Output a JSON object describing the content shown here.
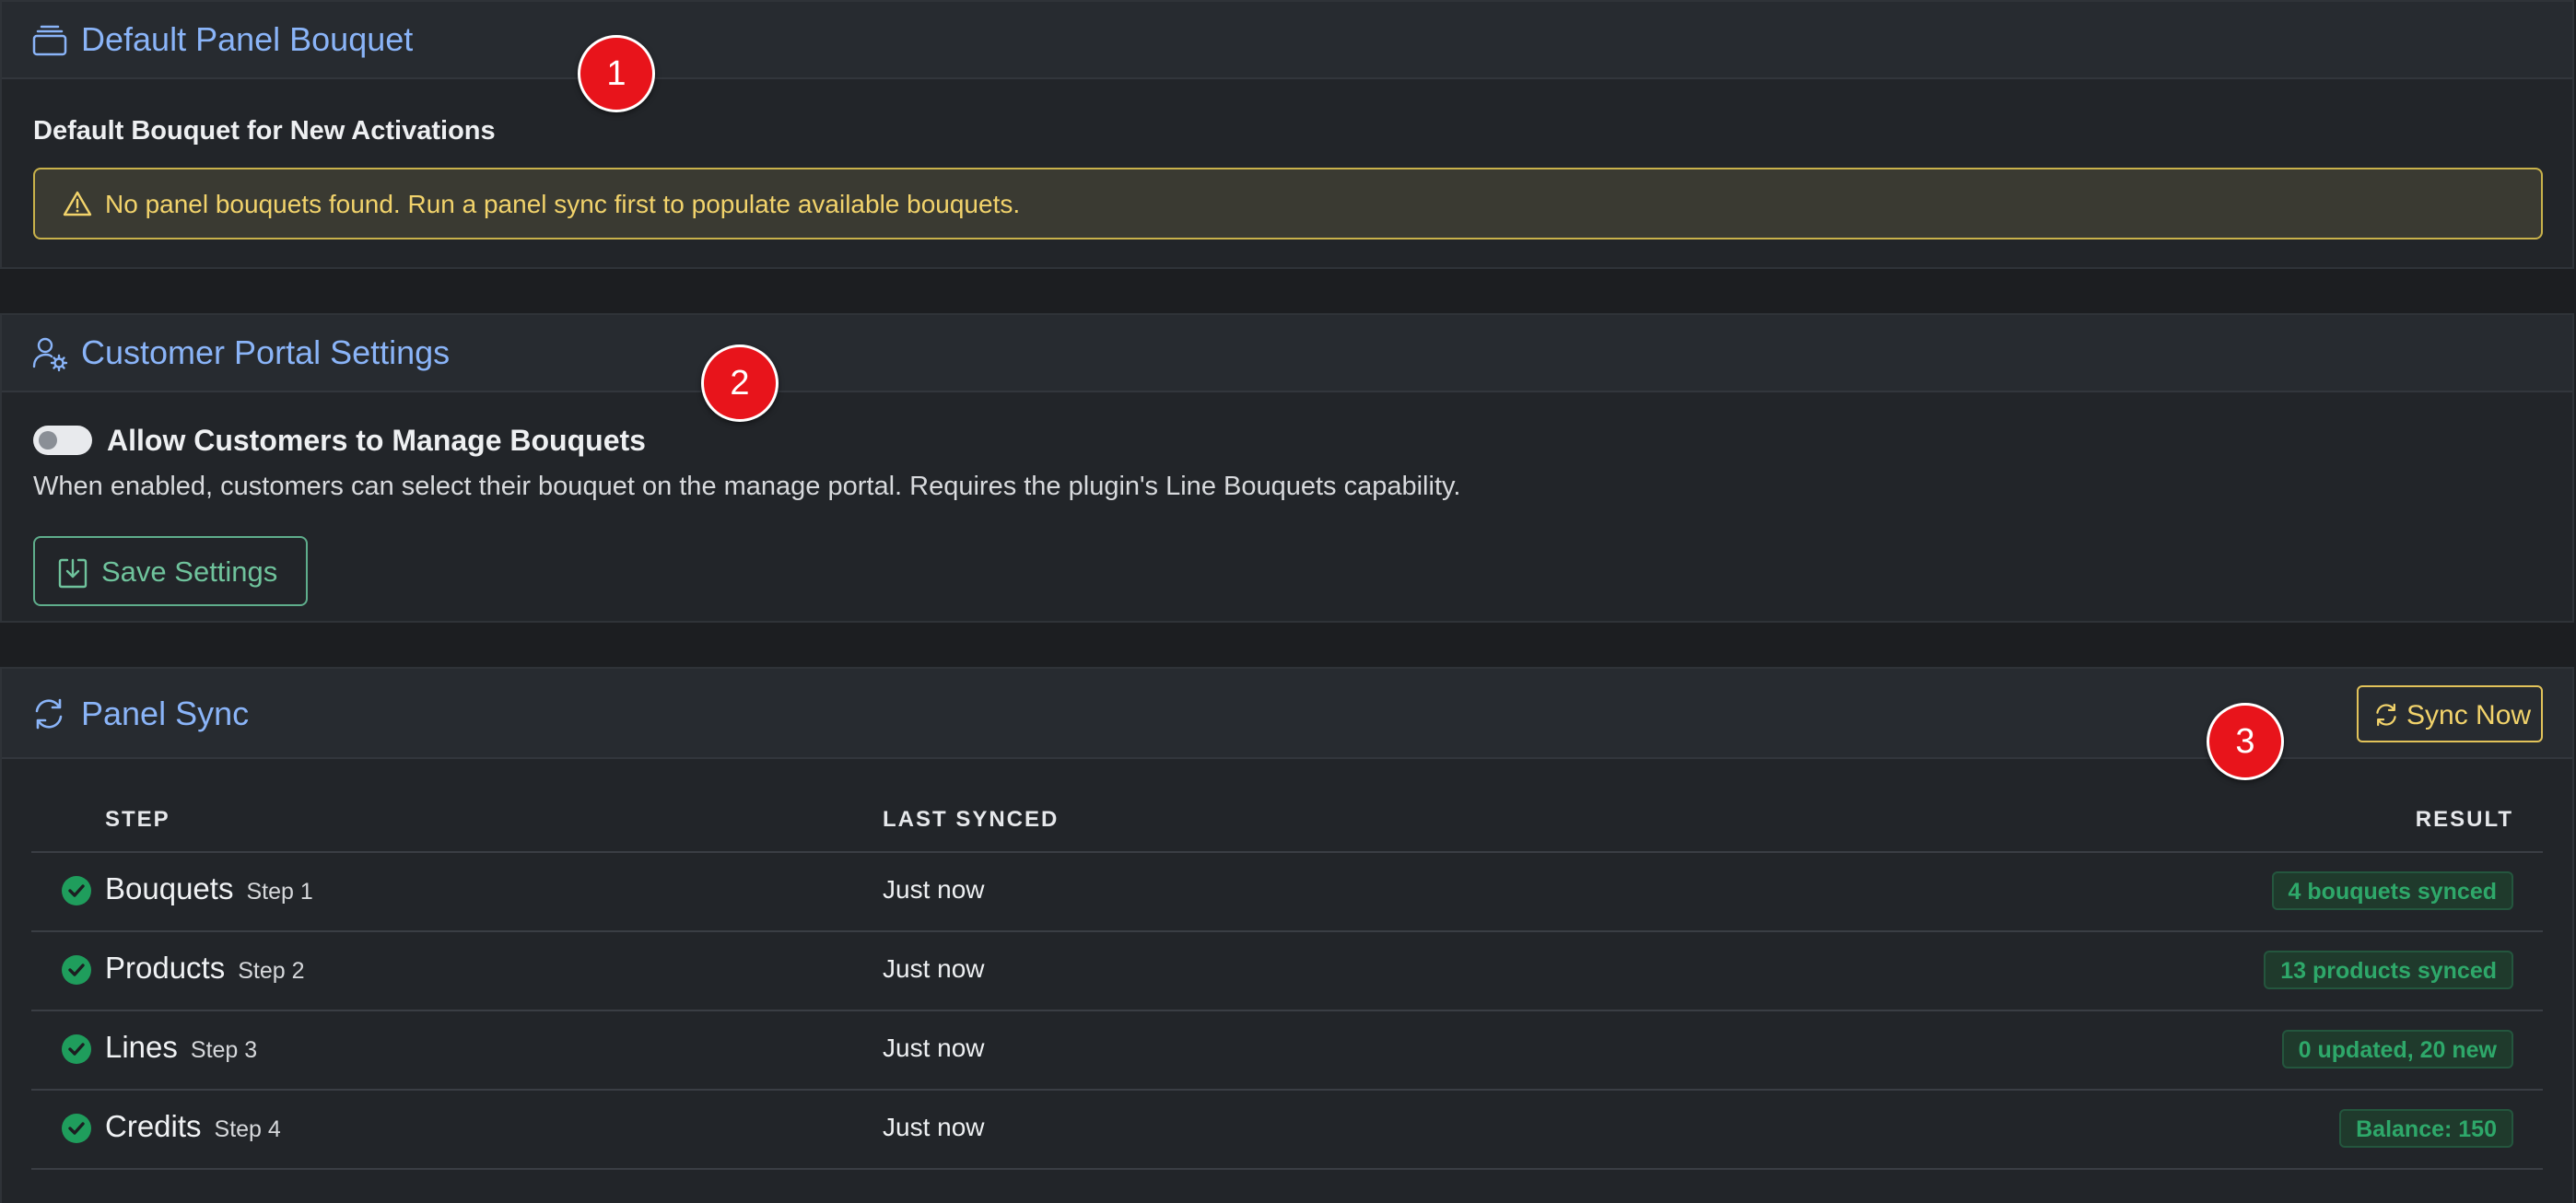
{
  "bouquet_card": {
    "title": "Default Panel Bouquet",
    "icon": "stack-icon",
    "field_label": "Default Bouquet for New Activations",
    "alert": {
      "icon": "warning-icon",
      "text": "No panel bouquets found. Run a panel sync first to populate available bouquets.",
      "color": "#f2d36b"
    }
  },
  "portal_card": {
    "title": "Customer Portal Settings",
    "icon": "user-gear-icon",
    "toggle": {
      "label": "Allow Customers to Manage Bouquets",
      "enabled": false
    },
    "help_text": "When enabled, customers can select their bouquet on the manage portal. Requires the plugin's Line Bouquets capability.",
    "save_button": {
      "label": "Save Settings",
      "icon": "save-icon",
      "color": "#6fc39c"
    }
  },
  "sync_card": {
    "title": "Panel Sync",
    "icon": "sync-icon",
    "sync_button": {
      "label": "Sync Now",
      "icon": "sync-icon",
      "color": "#f2d36b"
    },
    "columns": {
      "step": "STEP",
      "last_synced": "LAST SYNCED",
      "result": "RESULT"
    },
    "rows": [
      {
        "name": "Bouquets",
        "sub": "Step 1",
        "last_synced": "Just now",
        "result": "4 bouquets synced",
        "status": "success"
      },
      {
        "name": "Products",
        "sub": "Step 2",
        "last_synced": "Just now",
        "result": "13 products synced",
        "status": "success"
      },
      {
        "name": "Lines",
        "sub": "Step 3",
        "last_synced": "Just now",
        "result": "0 updated, 20 new",
        "status": "success"
      },
      {
        "name": "Credits",
        "sub": "Step 4",
        "last_synced": "Just now",
        "result": "Balance: 150",
        "status": "success"
      }
    ]
  },
  "markers": [
    "1",
    "2",
    "3"
  ],
  "colors": {
    "accent": "#8ab4f8",
    "success": "#2ea86a",
    "warning": "#f2d36b",
    "marker": "#e8141b"
  }
}
